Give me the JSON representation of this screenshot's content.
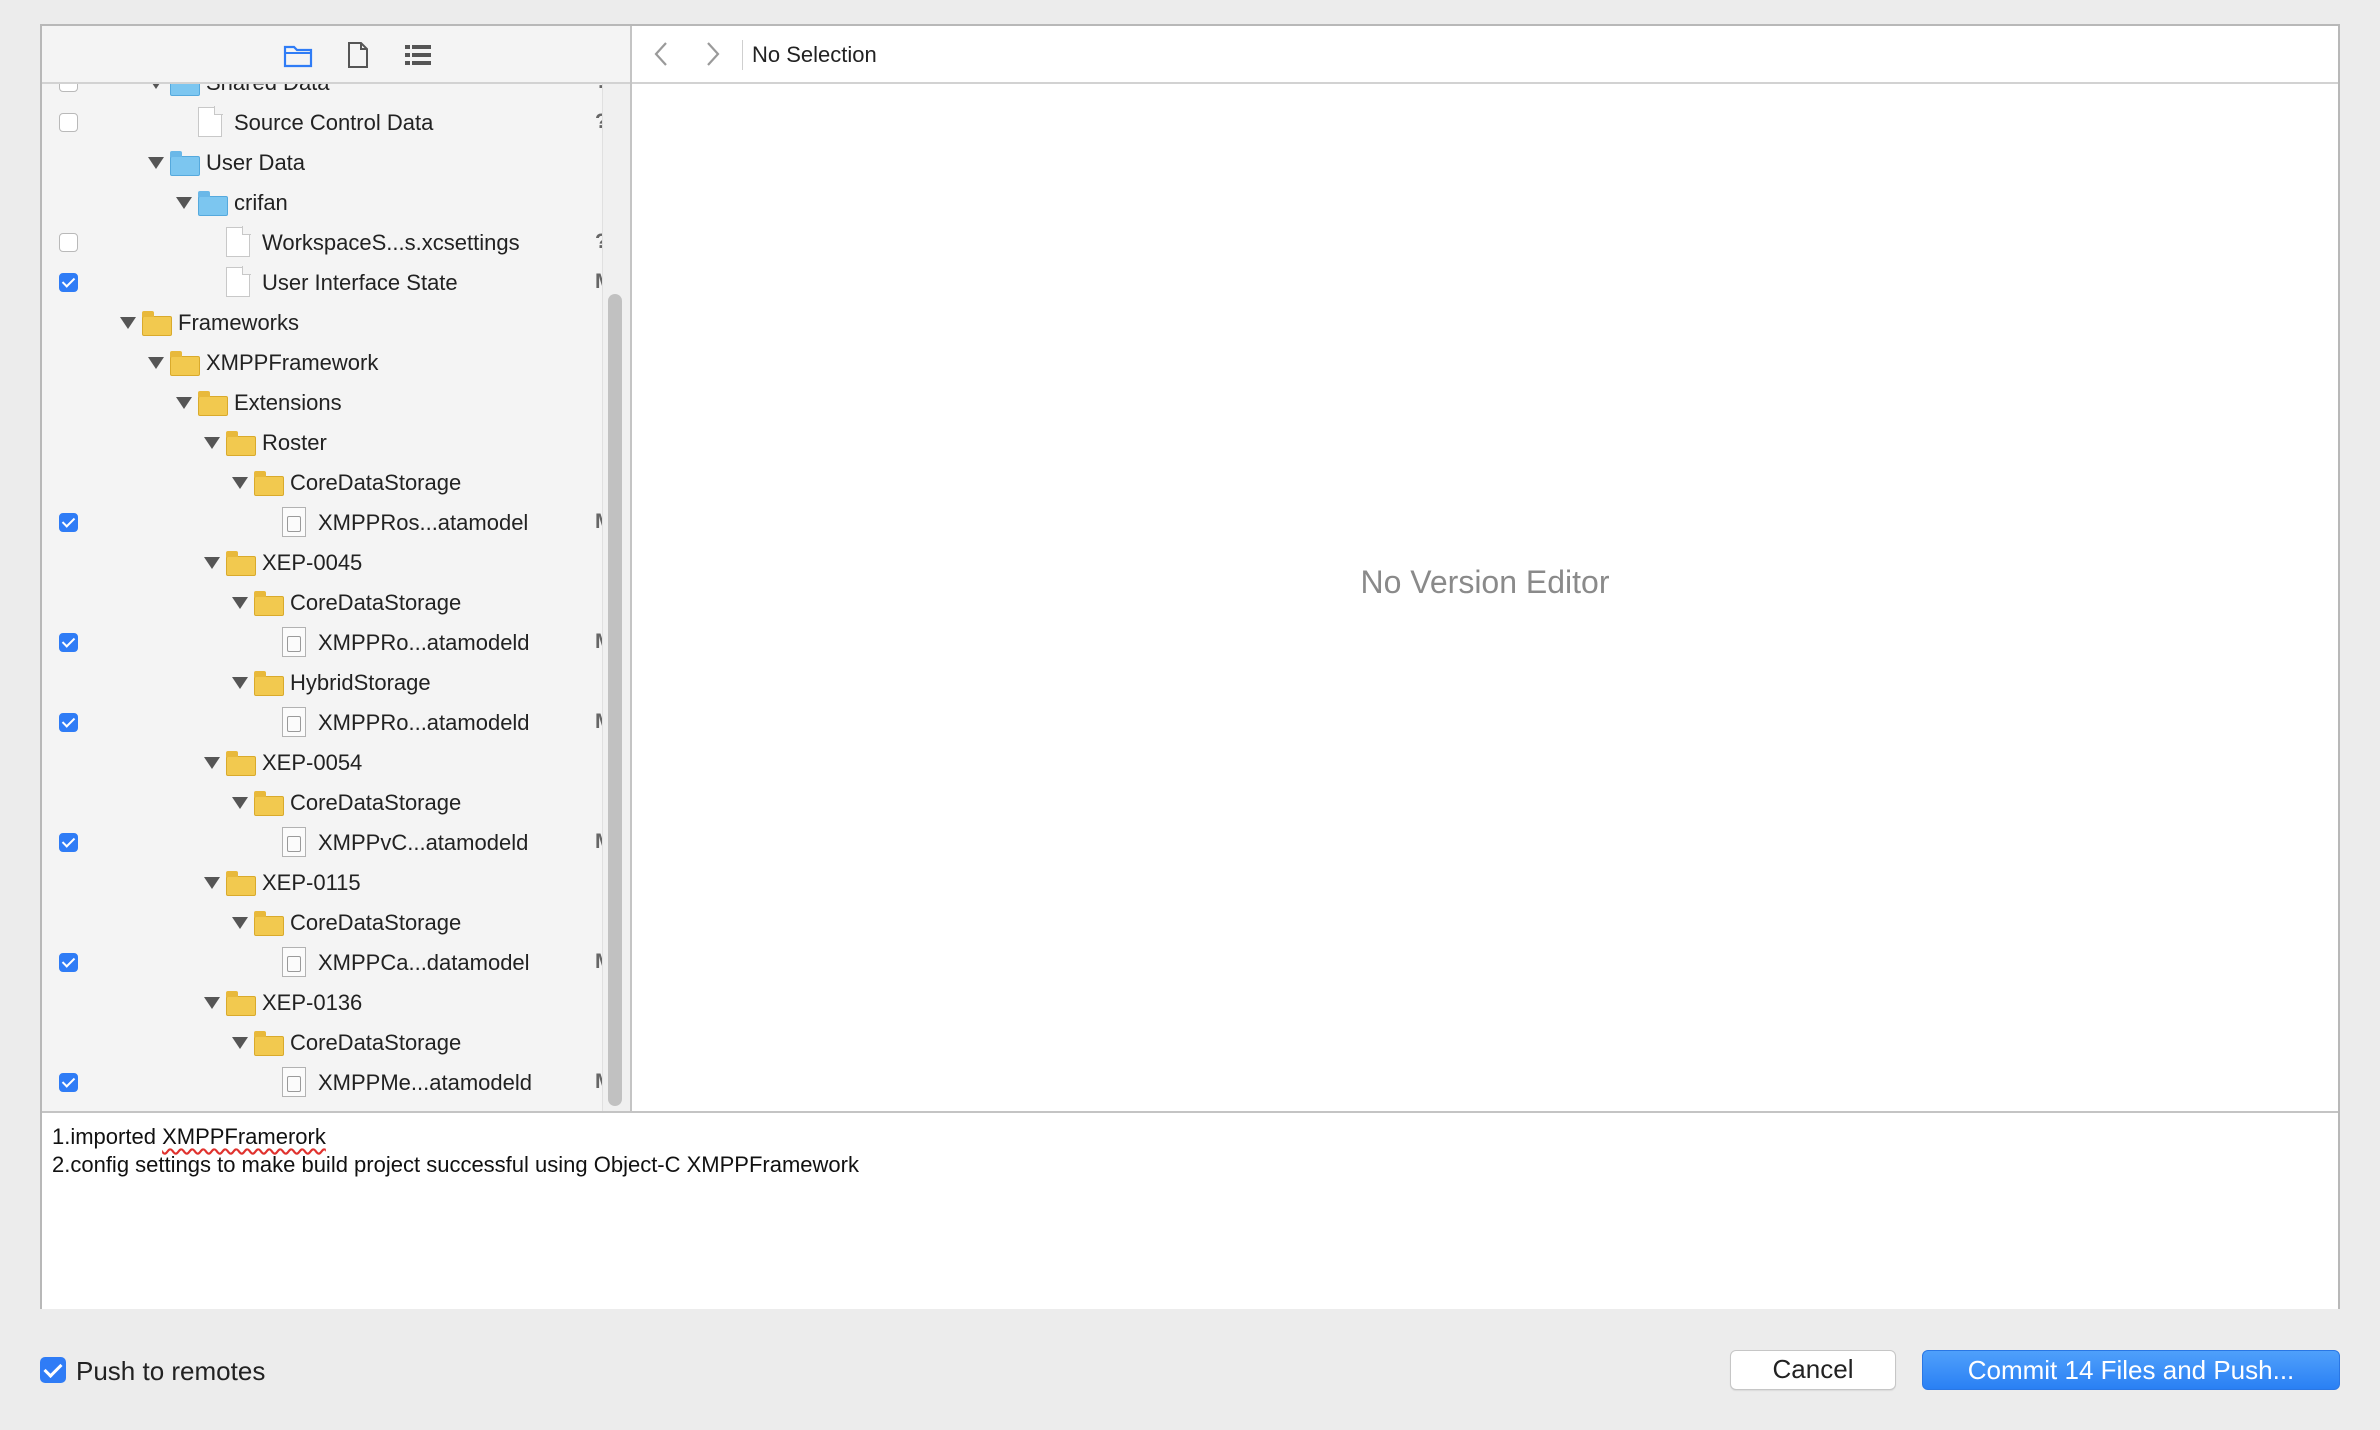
{
  "toolbar": {
    "left_icons": [
      "folder-icon",
      "file-icon",
      "list-icon"
    ],
    "selection_label": "No Selection"
  },
  "tree": [
    {
      "label": "Shared Data",
      "icon": "folder-blue",
      "depth": 4,
      "checkbox": "unchecked",
      "status": "?",
      "expanded": true
    },
    {
      "label": "Source Control Data",
      "icon": "file",
      "depth": 5,
      "checkbox": "unchecked",
      "status": "?"
    },
    {
      "label": "User Data",
      "icon": "folder-blue",
      "depth": 4,
      "checkbox": "none",
      "status": "",
      "expanded": true
    },
    {
      "label": "crifan",
      "icon": "folder-blue",
      "depth": 5,
      "checkbox": "none",
      "status": "",
      "expanded": true
    },
    {
      "label": "WorkspaceS...s.xcsettings",
      "icon": "file",
      "depth": 6,
      "checkbox": "unchecked",
      "status": "?"
    },
    {
      "label": "User Interface State",
      "icon": "file",
      "depth": 6,
      "checkbox": "checked",
      "status": "M"
    },
    {
      "label": "Frameworks",
      "icon": "folder-yellow",
      "depth": 3,
      "checkbox": "none",
      "status": "",
      "expanded": true
    },
    {
      "label": "XMPPFramework",
      "icon": "folder-yellow",
      "depth": 4,
      "checkbox": "none",
      "status": "",
      "expanded": true
    },
    {
      "label": "Extensions",
      "icon": "folder-yellow",
      "depth": 5,
      "checkbox": "none",
      "status": "",
      "expanded": true
    },
    {
      "label": "Roster",
      "icon": "folder-yellow",
      "depth": 6,
      "checkbox": "none",
      "status": "",
      "expanded": true
    },
    {
      "label": "CoreDataStorage",
      "icon": "folder-yellow",
      "depth": 7,
      "checkbox": "none",
      "status": "",
      "expanded": true
    },
    {
      "label": "XMPPRos...atamodel",
      "icon": "model",
      "depth": 8,
      "checkbox": "checked",
      "status": "M"
    },
    {
      "label": "XEP-0045",
      "icon": "folder-yellow",
      "depth": 6,
      "checkbox": "none",
      "status": "",
      "expanded": true
    },
    {
      "label": "CoreDataStorage",
      "icon": "folder-yellow",
      "depth": 7,
      "checkbox": "none",
      "status": "",
      "expanded": true
    },
    {
      "label": "XMPPRo...atamodeld",
      "icon": "model",
      "depth": 8,
      "checkbox": "checked",
      "status": "M"
    },
    {
      "label": "HybridStorage",
      "icon": "folder-yellow",
      "depth": 7,
      "checkbox": "none",
      "status": "",
      "expanded": true
    },
    {
      "label": "XMPPRo...atamodeld",
      "icon": "model",
      "depth": 8,
      "checkbox": "checked",
      "status": "M"
    },
    {
      "label": "XEP-0054",
      "icon": "folder-yellow",
      "depth": 6,
      "checkbox": "none",
      "status": "",
      "expanded": true
    },
    {
      "label": "CoreDataStorage",
      "icon": "folder-yellow",
      "depth": 7,
      "checkbox": "none",
      "status": "",
      "expanded": true
    },
    {
      "label": "XMPPvC...atamodeld",
      "icon": "model",
      "depth": 8,
      "checkbox": "checked",
      "status": "M"
    },
    {
      "label": "XEP-0115",
      "icon": "folder-yellow",
      "depth": 6,
      "checkbox": "none",
      "status": "",
      "expanded": true
    },
    {
      "label": "CoreDataStorage",
      "icon": "folder-yellow",
      "depth": 7,
      "checkbox": "none",
      "status": "",
      "expanded": true
    },
    {
      "label": "XMPPCa...datamodel",
      "icon": "model",
      "depth": 8,
      "checkbox": "checked",
      "status": "M"
    },
    {
      "label": "XEP-0136",
      "icon": "folder-yellow",
      "depth": 6,
      "checkbox": "none",
      "status": "",
      "expanded": true
    },
    {
      "label": "CoreDataStorage",
      "icon": "folder-yellow",
      "depth": 7,
      "checkbox": "none",
      "status": "",
      "expanded": true
    },
    {
      "label": "XMPPMe...atamodeld",
      "icon": "model",
      "depth": 8,
      "checkbox": "checked",
      "status": "M"
    }
  ],
  "editor": {
    "placeholder": "No Version Editor"
  },
  "commit_message": {
    "line1_prefix": "1.imported ",
    "line1_misspelled": "XMPPFramerork",
    "line2": "2.config settings to make build project successful using Object-C XMPPFramework"
  },
  "footer": {
    "push_label": "Push to remotes",
    "push_checked": true,
    "cancel_label": "Cancel",
    "commit_label": "Commit 14 Files and Push..."
  },
  "colors": {
    "accent": "#2f7cf6",
    "folder_yellow": "#f2c94f",
    "folder_blue": "#7cc6f0"
  }
}
